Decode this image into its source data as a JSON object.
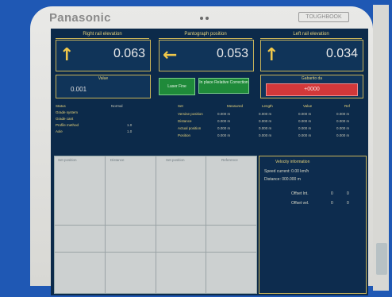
{
  "device": {
    "brand": "Panasonic",
    "brand_sub": "",
    "model_label": "TOUGHBOOK"
  },
  "headers": {
    "left": "Right rail elevation",
    "center": "Pantograph position",
    "right": "Left rail elevation"
  },
  "panels": [
    {
      "arrow": "↑",
      "value": "0.063"
    },
    {
      "arrow": "←",
      "value": "0.053"
    },
    {
      "arrow": "↑",
      "value": "0.034"
    }
  ],
  "row2": {
    "left_label": "Value",
    "left_value": "0.001",
    "green_btn_1": "Laser Fine",
    "green_btn_2": "In place Relative Correction",
    "red_label": "Gabarito da",
    "red_value": "+0000"
  },
  "table_left_labels": [
    "Status",
    "Grade system",
    "Grade cant",
    "Profile method",
    "Axle"
  ],
  "table_left_values": [
    "Normal",
    "",
    "",
    "1.0",
    "1.0"
  ],
  "table_right": {
    "header": [
      "Set",
      "Measured",
      "Length",
      "Value",
      "Ref"
    ],
    "rows": [
      [
        "Versine position",
        "0.000 m",
        "0.000 m",
        "0.000 m",
        "0.000 m"
      ],
      [
        "Distance",
        "0.000 m",
        "0.000 m",
        "0.000 m",
        "0.000 m"
      ],
      [
        "Actual position",
        "0.000 m",
        "0.000 m",
        "0.000 m",
        "0.000 m"
      ],
      [
        "Position",
        "0.000 m",
        "0.000 m",
        "0.000 m",
        "0.000 m"
      ]
    ]
  },
  "chart": {
    "headers": [
      "Set position",
      "Distance",
      "Set position",
      "Reference"
    ]
  },
  "side": {
    "title": "Velocity information",
    "lines": [
      "Speed current: 0.00 km/h",
      "Distance: 000.000 m"
    ],
    "rows": [
      [
        "Offset Int.",
        "0",
        "0"
      ],
      [
        "Offset vel.",
        "0",
        "0"
      ]
    ]
  }
}
